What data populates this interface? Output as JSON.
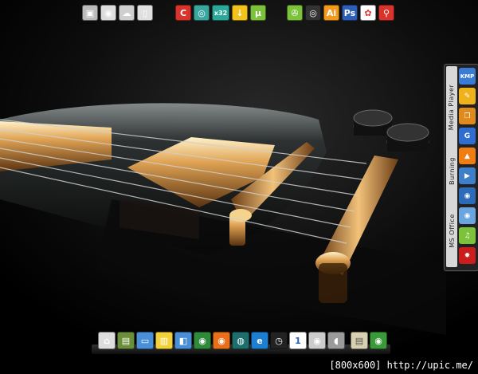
{
  "top_bar": {
    "groups": [
      {
        "items": [
          {
            "icon": "system-properties-icon",
            "color": "#bbbbbb",
            "glyph": "▣"
          },
          {
            "icon": "wifi-icon",
            "color": "#dddddd",
            "glyph": "◉"
          },
          {
            "icon": "network-cloud-icon",
            "color": "#cfcfcf",
            "glyph": "☁"
          },
          {
            "icon": "recycle-bin-icon",
            "color": "#e0e0e0",
            "glyph": "▯"
          }
        ]
      },
      {
        "items": [
          {
            "icon": "ccleaner-icon",
            "color": "#d9342b",
            "glyph": "C"
          },
          {
            "icon": "ring-app-icon",
            "color": "#3aa6a0",
            "glyph": "◎"
          },
          {
            "icon": "x32-icon",
            "color": "#2aa89a",
            "glyph": "x32"
          },
          {
            "icon": "download-arrow-icon",
            "color": "#f3c21b",
            "glyph": "↓"
          },
          {
            "icon": "utorrent-icon",
            "color": "#7cc23a",
            "glyph": "µ"
          }
        ]
      },
      {
        "items": [
          {
            "icon": "film-reel-icon",
            "color": "#7cc23a",
            "glyph": "✇"
          },
          {
            "icon": "disc-burner-icon",
            "color": "#333333",
            "glyph": "◎"
          },
          {
            "icon": "adobe-illustrator-icon",
            "color": "#f39a1c",
            "glyph": "Ai"
          },
          {
            "icon": "adobe-photoshop-icon",
            "color": "#2e5fb8",
            "glyph": "Ps"
          },
          {
            "icon": "picasa-icon",
            "color": "#ffffff",
            "glyph": "✿"
          },
          {
            "icon": "search-tool-icon",
            "color": "#d9342b",
            "glyph": "⚲"
          }
        ]
      }
    ]
  },
  "sidebar": {
    "tabs": [
      "Media Player",
      "Burning",
      "MS Office"
    ],
    "items": [
      {
        "icon": "kmp-player-icon",
        "color": "#3a7bd5",
        "glyph": "KMP"
      },
      {
        "icon": "feather-icon",
        "color": "#f0b21a",
        "glyph": "✎"
      },
      {
        "icon": "copy-tool-icon",
        "color": "#e08a1e",
        "glyph": "❐"
      },
      {
        "icon": "g-app-icon",
        "color": "#2f6ed0",
        "glyph": "G"
      },
      {
        "icon": "vlc-cone-icon",
        "color": "#f07d12",
        "glyph": "▲"
      },
      {
        "icon": "media-player-icon",
        "color": "#3d7fc9",
        "glyph": "▶"
      },
      {
        "icon": "nero-burn-icon",
        "color": "#2b6bb8",
        "glyph": "◉"
      },
      {
        "icon": "eye-icon",
        "color": "#6aa5e0",
        "glyph": "◉"
      },
      {
        "icon": "music-note-icon",
        "color": "#7cc23a",
        "glyph": "♫"
      },
      {
        "icon": "manchester-united-crest-icon",
        "color": "#cc1d1d",
        "glyph": "✹"
      }
    ]
  },
  "dock": {
    "items": [
      {
        "icon": "home-icon",
        "color": "#dddddd",
        "glyph": "⌂"
      },
      {
        "icon": "control-panel-icon",
        "color": "#6b8e3a",
        "glyph": "▤"
      },
      {
        "icon": "monitor-icon",
        "color": "#4a90d9",
        "glyph": "▭"
      },
      {
        "icon": "sticky-notes-icon",
        "color": "#f2d23b",
        "glyph": "▥"
      },
      {
        "icon": "gallery-icon",
        "color": "#4a8ed6",
        "glyph": "◧"
      },
      {
        "icon": "globe-ball-icon",
        "color": "#2f8a3a",
        "glyph": "◉"
      },
      {
        "icon": "firefox-icon",
        "color": "#e8701a",
        "glyph": "◉"
      },
      {
        "icon": "globe-grid-icon",
        "color": "#1e6e6e",
        "glyph": "◍"
      },
      {
        "icon": "internet-explorer-icon",
        "color": "#1c7fd0",
        "glyph": "e"
      },
      {
        "icon": "clock-icon",
        "color": "#222222",
        "glyph": "◷"
      },
      {
        "icon": "calendar-icon",
        "color": "#ffffff",
        "glyph": "1"
      },
      {
        "icon": "wifi-dock-icon",
        "color": "#cccccc",
        "glyph": "◉"
      },
      {
        "icon": "speaker-icon",
        "color": "#9a9a9a",
        "glyph": "◖"
      },
      {
        "icon": "notes-app-icon",
        "color": "#d8d0b0",
        "glyph": "▤"
      },
      {
        "icon": "globe-green-icon",
        "color": "#3a9a3a",
        "glyph": "◉"
      }
    ]
  },
  "footer": {
    "text": "[800x600] http://upic.me/"
  }
}
